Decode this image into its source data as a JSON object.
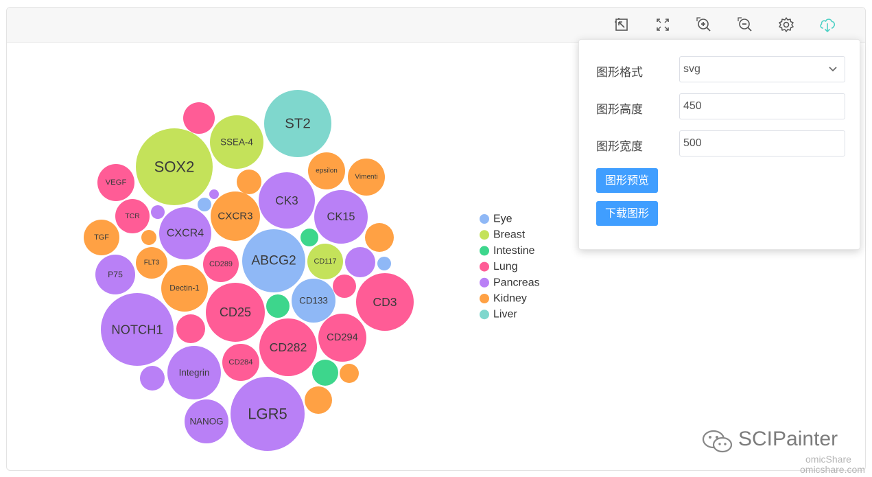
{
  "toolbar": {
    "icons": [
      "restore-icon",
      "fullscreen-icon",
      "zoom-in-icon",
      "zoom-out-icon",
      "gear-icon",
      "cloud-download-icon"
    ],
    "accent": "#4fd1c5"
  },
  "panel": {
    "format_label": "图形格式",
    "format_value": "svg",
    "height_label": "图形高度",
    "height_value": "450",
    "width_label": "图形宽度",
    "width_value": "500",
    "preview_button": "图形预览",
    "download_button": "下载图形",
    "button_color": "#409eff"
  },
  "watermark": {
    "brand": "SCIPainter",
    "site_line1": "omicShare",
    "site_line2": "omicshare.com"
  },
  "chart_data": {
    "type": "bubble",
    "legend_placement": "right",
    "categories": [
      {
        "name": "Eye",
        "color": "#8fb8f6"
      },
      {
        "name": "Breast",
        "color": "#c4e25a"
      },
      {
        "name": "Intestine",
        "color": "#3dd68c"
      },
      {
        "name": "Lung",
        "color": "#ff5c96"
      },
      {
        "name": "Pancreas",
        "color": "#b980f6"
      },
      {
        "name": "Kidney",
        "color": "#ffa144"
      },
      {
        "name": "Liver",
        "color": "#7fd7cd"
      }
    ],
    "bubbles": [
      {
        "label": "ST2",
        "category": "Liver",
        "size": 49
      },
      {
        "label": "SOX2",
        "category": "Breast",
        "size": 56
      },
      {
        "label": "SSEA-4",
        "category": "Breast",
        "size": 39
      },
      {
        "label": "",
        "category": "Lung",
        "size": 23
      },
      {
        "label": "VEGF",
        "category": "Lung",
        "size": 27
      },
      {
        "label": "epsilon",
        "category": "Kidney",
        "size": 27
      },
      {
        "label": "Vimenti",
        "category": "Kidney",
        "size": 27
      },
      {
        "label": "",
        "category": "Kidney",
        "size": 18
      },
      {
        "label": "CK3",
        "category": "Pancreas",
        "size": 41
      },
      {
        "label": "",
        "category": "Pancreas",
        "size": 7
      },
      {
        "label": "",
        "category": "Eye",
        "size": 10
      },
      {
        "label": "CXCR3",
        "category": "Kidney",
        "size": 36
      },
      {
        "label": "TCR",
        "category": "Lung",
        "size": 25
      },
      {
        "label": "",
        "category": "Pancreas",
        "size": 10
      },
      {
        "label": "CK15",
        "category": "Pancreas",
        "size": 39
      },
      {
        "label": "TGF",
        "category": "Kidney",
        "size": 26
      },
      {
        "label": "CXCR4",
        "category": "Pancreas",
        "size": 38
      },
      {
        "label": "",
        "category": "Kidney",
        "size": 11
      },
      {
        "label": "",
        "category": "Intestine",
        "size": 13
      },
      {
        "label": "",
        "category": "Kidney",
        "size": 21
      },
      {
        "label": "FLT3",
        "category": "Kidney",
        "size": 23
      },
      {
        "label": "CD289",
        "category": "Lung",
        "size": 26
      },
      {
        "label": "ABCG2",
        "category": "Eye",
        "size": 46
      },
      {
        "label": "CD117",
        "category": "Breast",
        "size": 26
      },
      {
        "label": "",
        "category": "Pancreas",
        "size": 22
      },
      {
        "label": "",
        "category": "Eye",
        "size": 10
      },
      {
        "label": "P75",
        "category": "Pancreas",
        "size": 29
      },
      {
        "label": "Dectin-1",
        "category": "Kidney",
        "size": 34
      },
      {
        "label": "CD133",
        "category": "Eye",
        "size": 32
      },
      {
        "label": "",
        "category": "Lung",
        "size": 17
      },
      {
        "label": "CD3",
        "category": "Lung",
        "size": 42
      },
      {
        "label": "CD25",
        "category": "Lung",
        "size": 43
      },
      {
        "label": "",
        "category": "Intestine",
        "size": 17
      },
      {
        "label": "NOTCH1",
        "category": "Pancreas",
        "size": 53
      },
      {
        "label": "",
        "category": "Lung",
        "size": 21
      },
      {
        "label": "CD282",
        "category": "Lung",
        "size": 42
      },
      {
        "label": "CD294",
        "category": "Lung",
        "size": 35
      },
      {
        "label": "Integrin",
        "category": "Pancreas",
        "size": 39
      },
      {
        "label": "CD284",
        "category": "Lung",
        "size": 27
      },
      {
        "label": "",
        "category": "Intestine",
        "size": 19
      },
      {
        "label": "",
        "category": "Kidney",
        "size": 14
      },
      {
        "label": "",
        "category": "Pancreas",
        "size": 18
      },
      {
        "label": "LGR5",
        "category": "Pancreas",
        "size": 54
      },
      {
        "label": "",
        "category": "Kidney",
        "size": 20
      },
      {
        "label": "NANOG",
        "category": "Pancreas",
        "size": 32
      }
    ]
  }
}
